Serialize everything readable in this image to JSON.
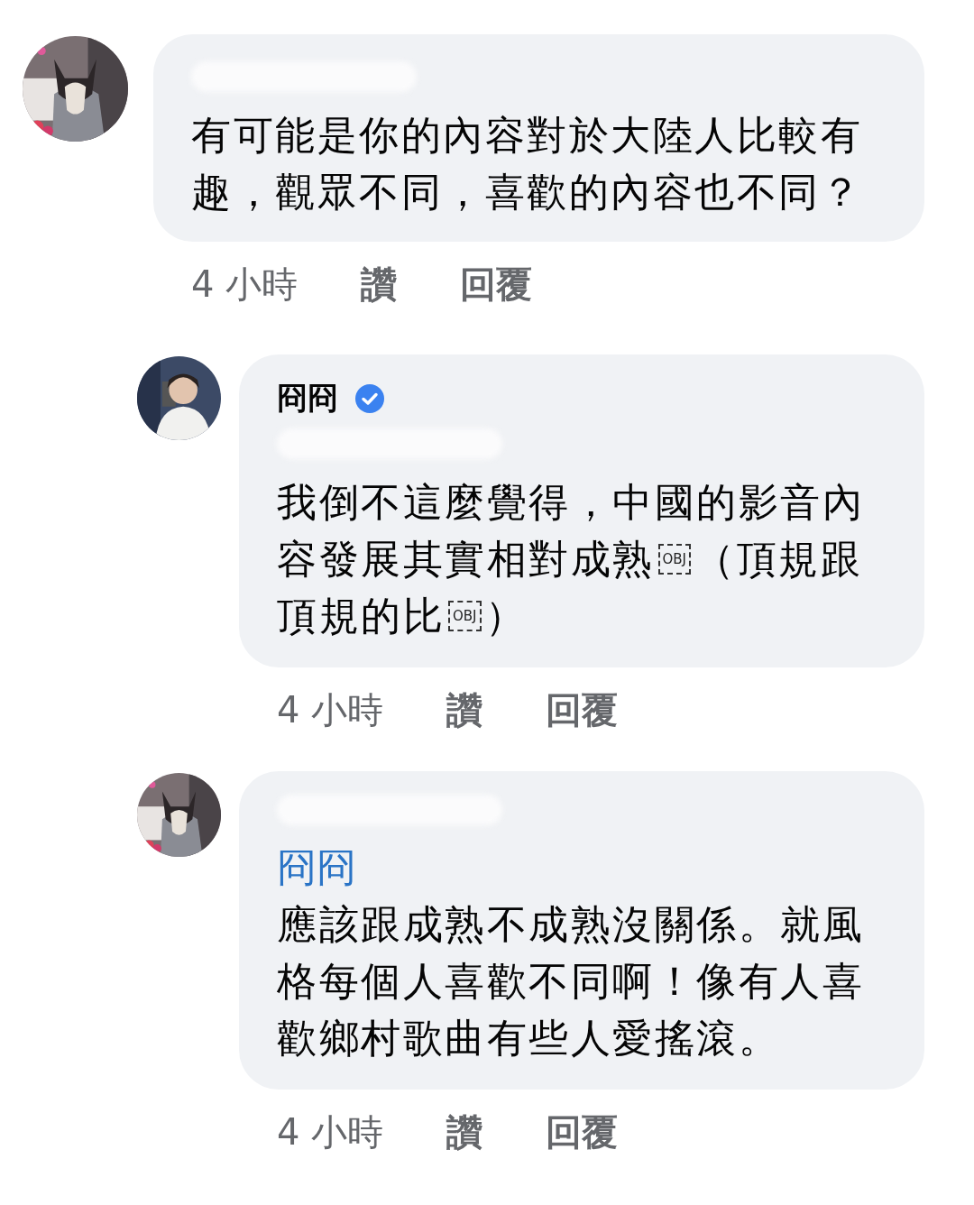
{
  "comments": [
    {
      "kind": "top",
      "avatar": {
        "kind": "picture"
      },
      "lines": [
        [
          {
            "kind": "text",
            "text": "有可能是你的內容對於大陸人比較有"
          }
        ],
        [
          {
            "kind": "text",
            "text": "趣，觀眾不同，喜歡的內容也不同？"
          }
        ]
      ],
      "time": "4 小時",
      "actions": [
        "讚",
        "回覆"
      ]
    },
    {
      "kind": "reply",
      "avatar": {
        "kind": "picture"
      },
      "author": "冏冏",
      "verified": true,
      "lines": [
        [
          {
            "kind": "text",
            "text": "我倒不這麼覺得，中國的影音內"
          }
        ],
        [
          {
            "kind": "text",
            "text": "容發展其實相對成熟"
          },
          {
            "kind": "obj",
            "text": "OBJ"
          },
          {
            "kind": "text",
            "text": "（頂規跟"
          }
        ],
        [
          {
            "kind": "text",
            "text": "頂規的比"
          },
          {
            "kind": "obj",
            "text": "OBJ"
          },
          {
            "kind": "text",
            "text": "）"
          }
        ]
      ],
      "time": "4 小時",
      "actions": [
        "讚",
        "回覆"
      ]
    },
    {
      "kind": "reply",
      "avatar": {
        "kind": "picture"
      },
      "mention": "冏冏",
      "lines": [
        [
          {
            "kind": "text",
            "text": "應該跟成熟不成熟沒關係。就風"
          }
        ],
        [
          {
            "kind": "text",
            "text": "格每個人喜歡不同啊！像有人喜"
          }
        ],
        [
          {
            "kind": "text",
            "text": "歡鄉村歌曲有些人愛搖滾。"
          }
        ]
      ],
      "time": "4 小時",
      "actions": [
        "讚",
        "回覆"
      ]
    }
  ]
}
